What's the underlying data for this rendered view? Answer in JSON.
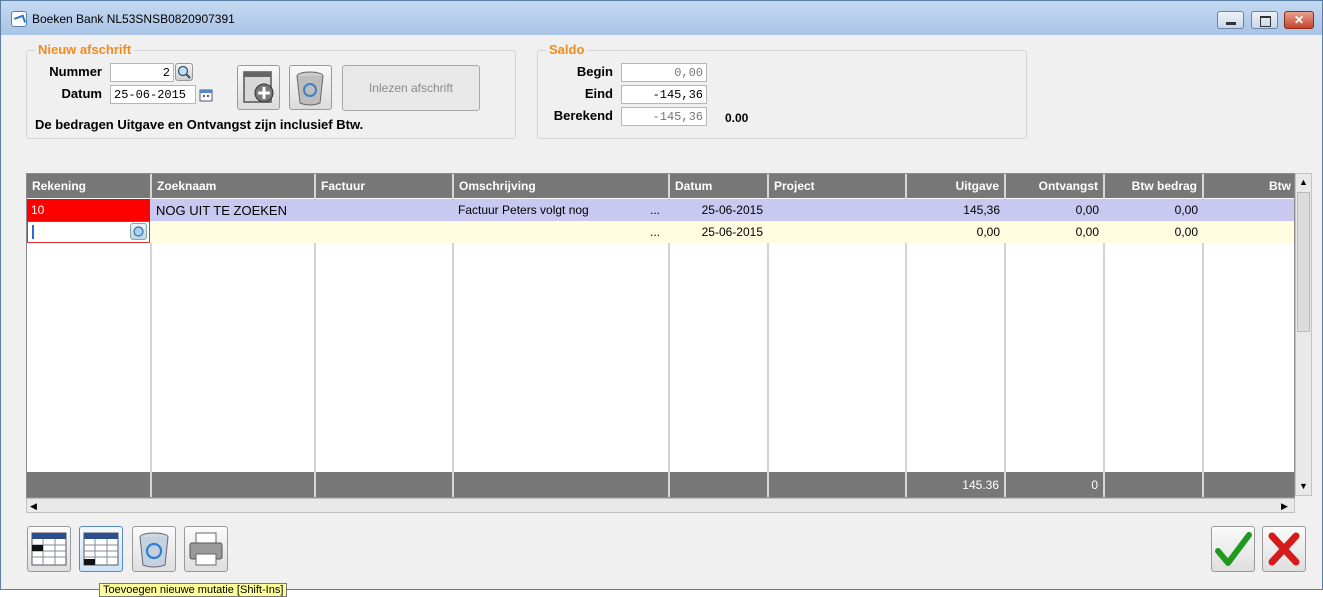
{
  "window": {
    "title": "Boeken Bank NL53SNSB0820907391"
  },
  "nieuw_afschrift": {
    "legend": "Nieuw afschrift",
    "nummer_label": "Nummer",
    "nummer_value": "2",
    "datum_label": "Datum",
    "datum_value": "25-06-2015",
    "inlezen_label": "Inlezen afschrift",
    "note": "De bedragen Uitgave en Ontvangst zijn inclusief Btw."
  },
  "saldo": {
    "legend": "Saldo",
    "begin_label": "Begin",
    "begin_value": "0,00",
    "eind_label": "Eind",
    "eind_value": "-145,36",
    "berekend_label": "Berekend",
    "berekend_value": "-145,36",
    "difference": "0.00"
  },
  "grid": {
    "columns": [
      "Rekening",
      "Zoeknaam",
      "Factuur",
      "Omschrijving",
      "Datum",
      "Project",
      "Uitgave",
      "Ontvangst",
      "Btw bedrag",
      "Btw"
    ],
    "rows": [
      {
        "rekening": "10",
        "zoeknaam": "NOG UIT TE ZOEKEN",
        "factuur": "",
        "omschrijving": "Factuur Peters volgt nog",
        "ellipsis": "...",
        "datum": "25-06-2015",
        "project": "",
        "uitgave": "145,36",
        "ontvangst": "0,00",
        "btw_bedrag": "0,00",
        "btw": ""
      },
      {
        "rekening": "",
        "zoeknaam": "",
        "factuur": "",
        "omschrijving": "",
        "ellipsis": "...",
        "datum": "25-06-2015",
        "project": "",
        "uitgave": "0,00",
        "ontvangst": "0,00",
        "btw_bedrag": "0,00",
        "btw": ""
      }
    ],
    "totals": {
      "uitgave": "145.36",
      "ontvangst": "0"
    }
  },
  "tooltip": "Toevoegen nieuwe mutatie  [Shift-Ins]",
  "colors": {
    "accent_orange": "#f08c1d",
    "header_gray": "#777777",
    "row_selected": "#c8c8f0",
    "row_new": "#fffce0",
    "error_red": "#ff0000"
  }
}
